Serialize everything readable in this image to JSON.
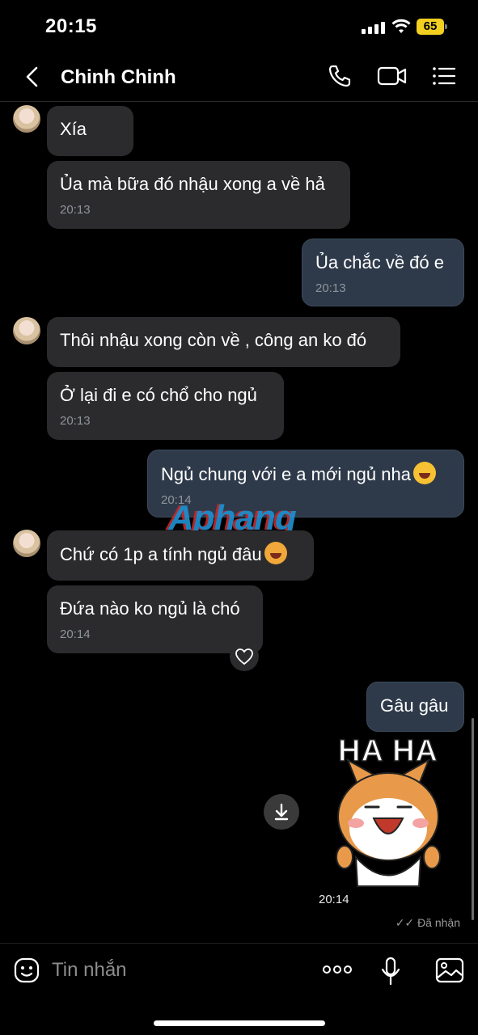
{
  "status": {
    "time": "20:15",
    "battery": "65"
  },
  "header": {
    "name": "Chinh Chinh"
  },
  "messages": [
    {
      "text": "Xía"
    },
    {
      "text": "Ủa mà bữa đó nhậu xong a về hả",
      "time": "20:13"
    },
    {
      "text": "Ủa chắc về đó e",
      "time": "20:13"
    },
    {
      "text": "Thôi nhậu xong còn về , công an ko đó"
    },
    {
      "text": "Ở lại đi e có chổ cho ngủ",
      "time": "20:13"
    },
    {
      "text": "Ngủ chung với e a mới ngủ nha",
      "time": "20:14"
    },
    {
      "text": "Chứ có 1p a tính ngủ đâu"
    },
    {
      "text": "Đứa nào ko ngủ là chó",
      "time": "20:14"
    },
    {
      "text": "Gâu gâu"
    }
  ],
  "sticker": {
    "caption": "HA HA",
    "time": "20:14"
  },
  "delivery_status": "Đã nhận",
  "watermark": "Aphang",
  "composer": {
    "placeholder": "Tin nhắn"
  },
  "icons": {
    "back": "chevron-left-icon",
    "call": "phone-icon",
    "video": "video-camera-icon",
    "menu": "list-menu-icon",
    "emoji": "sticker-face-icon",
    "more": "more-dots-icon",
    "mic": "microphone-icon",
    "gallery": "image-icon",
    "download": "download-icon",
    "heart": "heart-icon"
  },
  "colors": {
    "incoming": "#2b2b2d",
    "outgoing": "#2e3a4a",
    "battery": "#f2cf20"
  }
}
